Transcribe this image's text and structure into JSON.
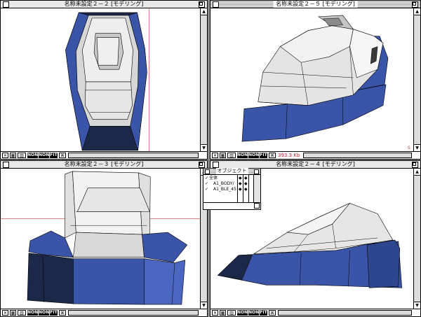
{
  "windows": {
    "top_left": {
      "title": "名称未設定２－２ [モデリング]"
    },
    "top_right": {
      "title": "名称未設定２－５ [モデリング]",
      "readout": "393.3 Kb"
    },
    "bottom_left": {
      "title": "名称未設定２－３ [モデリング]"
    },
    "bottom_right": {
      "title": "名称未設定２－４ [モデリング]"
    }
  },
  "statusbar": {
    "buttons": [
      "NONE",
      "NONE",
      "FIT"
    ]
  },
  "object_palette": {
    "title": "オブジェクト",
    "items": [
      {
        "check": "✓",
        "name": "全体",
        "flag1": "◆",
        "flag2": "◆"
      },
      {
        "check": "✓",
        "name": "A1_BODY/",
        "flag1": "◆",
        "flag2": "◆"
      },
      {
        "check": "✓",
        "name": "A1_BLE_45",
        "flag1": "◆",
        "flag2": "◆"
      }
    ]
  },
  "colors": {
    "model_blue": "#3a54a8",
    "model_dark": "#1c2848",
    "model_light": "#e6e6e6",
    "guide_red": "#e08080"
  }
}
